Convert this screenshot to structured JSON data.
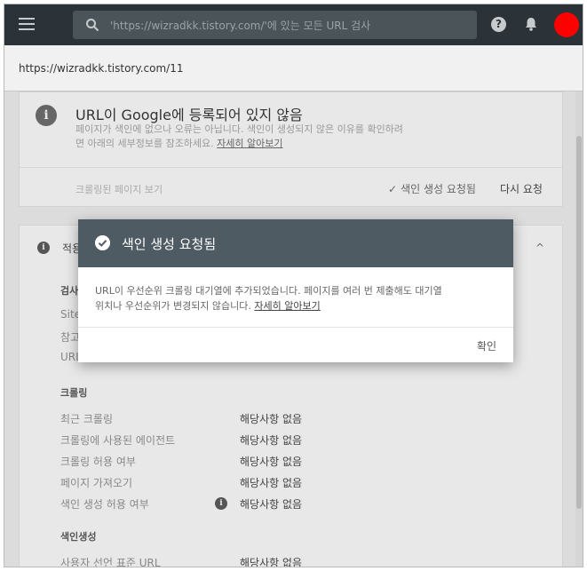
{
  "header": {
    "search_placeholder": "'https://wizradkk.tistory.com/'에 있는 모든 URL 검사",
    "help_glyph": "?"
  },
  "url_bar": {
    "url": "https://wizradkk.tistory.com/11"
  },
  "status_card": {
    "info_glyph": "i",
    "title": "URL이 Google에 등록되어 있지 않음",
    "desc_line1": "페이지가 색인에 없으나 오류는 아닙니다. 색인이 생성되지 않은 이유를 확인하려",
    "desc_line2": "면 아래의 세부정보를 참조하세요. ",
    "desc_link": "자세히 알아보기",
    "crawled_page_link": "크롤링된 페이지 보기",
    "requested_check": "✓",
    "requested_label": "색인 생성 요청됨",
    "rerequest_label": "다시 요청"
  },
  "coverage_card": {
    "info_glyph": "i",
    "title_partial": "적용",
    "chevron": "^",
    "discovery_label_partial": "검사",
    "discovery_rows": [
      "Site",
      "참고",
      "URL"
    ],
    "crawl_section": "크롤링",
    "crawl_rows": [
      {
        "label": "최근 크롤링",
        "value": "해당사항 없음"
      },
      {
        "label": "크롤링에 사용된 에이전트",
        "value": "해당사항 없음"
      },
      {
        "label": "크롤링 허용 여부",
        "value": "해당사항 없음"
      },
      {
        "label": "페이지 가져오기",
        "value": "해당사항 없음"
      },
      {
        "label": "색인 생성 허용 여부",
        "value": "해당사항 없음"
      }
    ],
    "index_section": "색인생성",
    "index_rows": [
      {
        "label": "사용자 선언 표준 URL",
        "value": "해당사항 없음"
      }
    ]
  },
  "dialog": {
    "title": "색인 생성 요청됨",
    "body_line1": "URL이 우선순위 크롤링 대기열에 추가되었습니다. 페이지를 여러 번 제출해도 대기열",
    "body_line2": "위치나 우선순위가 변경되지 않습니다. ",
    "body_link": "자세히 알아보기",
    "ok_label": "확인"
  },
  "colors": {
    "topbar": "#2b3338",
    "dialog_header": "#4f5b63",
    "avatar": "#ff0000"
  }
}
